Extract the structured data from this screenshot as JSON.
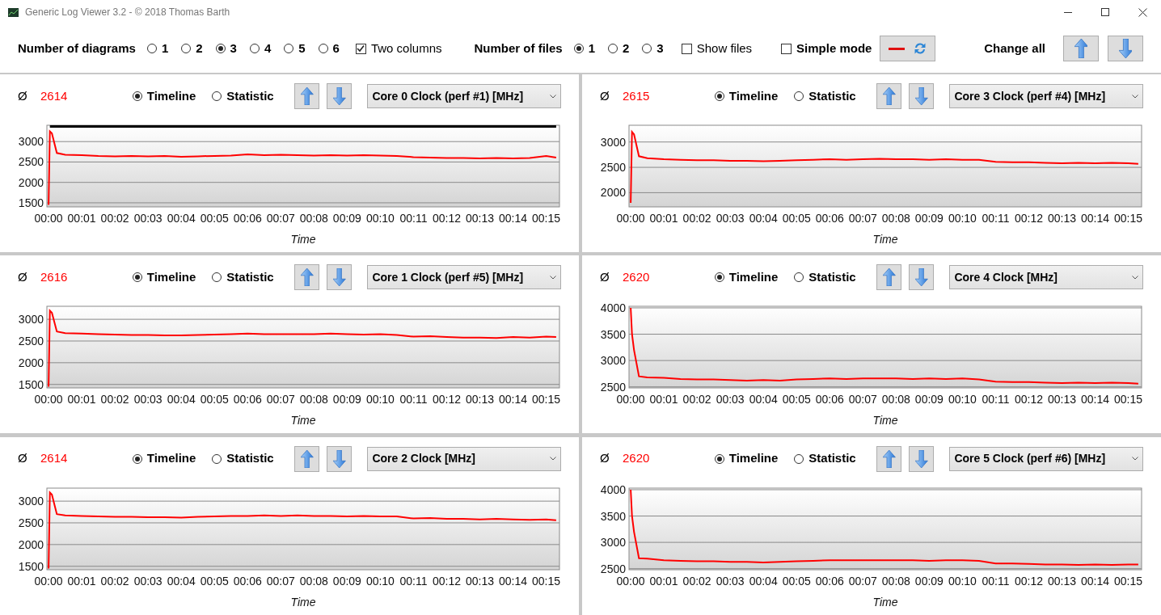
{
  "window": {
    "title": "Generic Log Viewer 3.2 - © 2018 Thomas Barth"
  },
  "toolbar": {
    "diagrams_label": "Number of diagrams",
    "diagram_options": [
      {
        "label": "1",
        "selected": false
      },
      {
        "label": "2",
        "selected": false
      },
      {
        "label": "3",
        "selected": true
      },
      {
        "label": "4",
        "selected": false
      },
      {
        "label": "5",
        "selected": false
      },
      {
        "label": "6",
        "selected": false
      }
    ],
    "two_columns": {
      "label": "Two columns",
      "checked": true
    },
    "files_label": "Number of files",
    "file_options": [
      {
        "label": "1",
        "selected": true
      },
      {
        "label": "2",
        "selected": false
      },
      {
        "label": "3",
        "selected": false
      }
    ],
    "show_files": {
      "label": "Show files",
      "checked": false
    },
    "simple_mode": {
      "label": "Simple mode",
      "checked": false
    },
    "change_all_label": "Change all"
  },
  "panels": [
    {
      "avg_symbol": "Ø",
      "average": "2614",
      "views": [
        {
          "label": "Timeline",
          "selected": true
        },
        {
          "label": "Statistic",
          "selected": false
        }
      ],
      "channel": "Core 0 Clock (perf #1) [MHz]",
      "chart_data": {
        "type": "line",
        "grid": true,
        "xlabel": "Time",
        "x": [
          0,
          0.04,
          0.1,
          0.25,
          0.5,
          1,
          1.5,
          2,
          2.5,
          3,
          3.5,
          4,
          4.5,
          5,
          5.5,
          6,
          6.5,
          7,
          7.5,
          8,
          8.5,
          9,
          9.5,
          10,
          10.5,
          11,
          11.5,
          12,
          12.5,
          13,
          13.5,
          14,
          14.5,
          15,
          15.3
        ],
        "series": [
          {
            "color": "#ff0000",
            "values": [
              1450,
              3250,
              3200,
              2720,
              2680,
              2670,
              2650,
              2640,
              2650,
              2640,
              2650,
              2630,
              2640,
              2650,
              2660,
              2690,
              2670,
              2680,
              2670,
              2660,
              2670,
              2660,
              2670,
              2660,
              2650,
              2620,
              2610,
              2600,
              2600,
              2590,
              2600,
              2590,
              2600,
              2650,
              2610
            ]
          },
          {
            "color": "#000000",
            "values": [
              null,
              3370,
              3370,
              3370,
              3370,
              3370,
              3370,
              3370,
              3370,
              3370,
              3370,
              3370,
              3370,
              3370,
              3370,
              3370,
              3370,
              3370,
              3370,
              3370,
              3370,
              3370,
              3370,
              3370,
              3370,
              3370,
              3370,
              3370,
              3370,
              3370,
              3370,
              3370,
              3370,
              3370,
              3370
            ]
          }
        ],
        "xlim": [
          -0.05,
          15.4
        ],
        "ylim": [
          1400,
          3400
        ],
        "xticks": [
          {
            "value": 0,
            "label": "00:00"
          },
          {
            "value": 1,
            "label": "00:01"
          },
          {
            "value": 2,
            "label": "00:02"
          },
          {
            "value": 3,
            "label": "00:03"
          },
          {
            "value": 4,
            "label": "00:04"
          },
          {
            "value": 5,
            "label": "00:05"
          },
          {
            "value": 6,
            "label": "00:06"
          },
          {
            "value": 7,
            "label": "00:07"
          },
          {
            "value": 8,
            "label": "00:08"
          },
          {
            "value": 9,
            "label": "00:09"
          },
          {
            "value": 10,
            "label": "00:10"
          },
          {
            "value": 11,
            "label": "00:11"
          },
          {
            "value": 12,
            "label": "00:12"
          },
          {
            "value": 13,
            "label": "00:13"
          },
          {
            "value": 14,
            "label": "00:14"
          },
          {
            "value": 15,
            "label": "00:15"
          }
        ],
        "yticks": [
          1500,
          2000,
          2500,
          3000
        ]
      }
    },
    {
      "avg_symbol": "Ø",
      "average": "2615",
      "views": [
        {
          "label": "Timeline",
          "selected": true
        },
        {
          "label": "Statistic",
          "selected": false
        }
      ],
      "channel": "Core 3 Clock (perf #4) [MHz]",
      "chart_data": {
        "type": "line",
        "grid": true,
        "xlabel": "Time",
        "x": [
          0,
          0.04,
          0.1,
          0.25,
          0.5,
          1,
          1.5,
          2,
          2.5,
          3,
          3.5,
          4,
          4.5,
          5,
          5.5,
          6,
          6.5,
          7,
          7.5,
          8,
          8.5,
          9,
          9.5,
          10,
          10.5,
          11,
          11.5,
          12,
          12.5,
          13,
          13.5,
          14,
          14.5,
          15,
          15.3
        ],
        "series": [
          {
            "color": "#ff0000",
            "values": [
              1800,
              3200,
              3150,
              2720,
              2680,
              2660,
              2650,
              2640,
              2640,
              2630,
              2630,
              2620,
              2630,
              2640,
              2650,
              2660,
              2650,
              2660,
              2670,
              2660,
              2660,
              2650,
              2660,
              2650,
              2650,
              2610,
              2600,
              2600,
              2590,
              2580,
              2590,
              2580,
              2590,
              2580,
              2570
            ]
          }
        ],
        "xlim": [
          -0.05,
          15.4
        ],
        "ylim": [
          1720,
          3330
        ],
        "xticks": [
          {
            "value": 0,
            "label": "00:00"
          },
          {
            "value": 1,
            "label": "00:01"
          },
          {
            "value": 2,
            "label": "00:02"
          },
          {
            "value": 3,
            "label": "00:03"
          },
          {
            "value": 4,
            "label": "00:04"
          },
          {
            "value": 5,
            "label": "00:05"
          },
          {
            "value": 6,
            "label": "00:06"
          },
          {
            "value": 7,
            "label": "00:07"
          },
          {
            "value": 8,
            "label": "00:08"
          },
          {
            "value": 9,
            "label": "00:09"
          },
          {
            "value": 10,
            "label": "00:10"
          },
          {
            "value": 11,
            "label": "00:11"
          },
          {
            "value": 12,
            "label": "00:12"
          },
          {
            "value": 13,
            "label": "00:13"
          },
          {
            "value": 14,
            "label": "00:14"
          },
          {
            "value": 15,
            "label": "00:15"
          }
        ],
        "yticks": [
          2000,
          2500,
          3000
        ]
      }
    },
    {
      "avg_symbol": "Ø",
      "average": "2616",
      "views": [
        {
          "label": "Timeline",
          "selected": true
        },
        {
          "label": "Statistic",
          "selected": false
        }
      ],
      "channel": "Core 1 Clock (perf #5) [MHz]",
      "chart_data": {
        "type": "line",
        "grid": true,
        "xlabel": "Time",
        "x": [
          0,
          0.04,
          0.1,
          0.25,
          0.5,
          1,
          1.5,
          2,
          2.5,
          3,
          3.5,
          4,
          4.5,
          5,
          5.5,
          6,
          6.5,
          7,
          7.5,
          8,
          8.5,
          9,
          9.5,
          10,
          10.5,
          11,
          11.5,
          12,
          12.5,
          13,
          13.5,
          14,
          14.5,
          15,
          15.3
        ],
        "series": [
          {
            "color": "#ff0000",
            "values": [
              1450,
              3200,
              3150,
              2720,
              2680,
              2670,
              2660,
              2650,
              2640,
              2640,
              2630,
              2630,
              2640,
              2650,
              2660,
              2670,
              2660,
              2660,
              2660,
              2660,
              2670,
              2660,
              2650,
              2660,
              2640,
              2600,
              2610,
              2590,
              2580,
              2580,
              2570,
              2590,
              2580,
              2600,
              2590
            ]
          }
        ],
        "xlim": [
          -0.05,
          15.4
        ],
        "ylim": [
          1420,
          3300
        ],
        "xticks": [
          {
            "value": 0,
            "label": "00:00"
          },
          {
            "value": 1,
            "label": "00:01"
          },
          {
            "value": 2,
            "label": "00:02"
          },
          {
            "value": 3,
            "label": "00:03"
          },
          {
            "value": 4,
            "label": "00:04"
          },
          {
            "value": 5,
            "label": "00:05"
          },
          {
            "value": 6,
            "label": "00:06"
          },
          {
            "value": 7,
            "label": "00:07"
          },
          {
            "value": 8,
            "label": "00:08"
          },
          {
            "value": 9,
            "label": "00:09"
          },
          {
            "value": 10,
            "label": "00:10"
          },
          {
            "value": 11,
            "label": "00:11"
          },
          {
            "value": 12,
            "label": "00:12"
          },
          {
            "value": 13,
            "label": "00:13"
          },
          {
            "value": 14,
            "label": "00:14"
          },
          {
            "value": 15,
            "label": "00:15"
          }
        ],
        "yticks": [
          1500,
          2000,
          2500,
          3000
        ]
      }
    },
    {
      "avg_symbol": "Ø",
      "average": "2620",
      "views": [
        {
          "label": "Timeline",
          "selected": true
        },
        {
          "label": "Statistic",
          "selected": false
        }
      ],
      "channel": "Core 4 Clock [MHz]",
      "chart_data": {
        "type": "line",
        "grid": true,
        "xlabel": "Time",
        "x": [
          0,
          0.04,
          0.1,
          0.25,
          0.5,
          1,
          1.5,
          2,
          2.5,
          3,
          3.5,
          4,
          4.5,
          5,
          5.5,
          6,
          6.5,
          7,
          7.5,
          8,
          8.5,
          9,
          9.5,
          10,
          10.5,
          11,
          11.5,
          12,
          12.5,
          13,
          13.5,
          14,
          14.5,
          15,
          15.3
        ],
        "series": [
          {
            "color": "#ff0000",
            "values": [
              4000,
              3500,
              3200,
              2700,
              2680,
              2670,
              2650,
              2640,
              2640,
              2630,
              2620,
              2630,
              2620,
              2640,
              2650,
              2660,
              2650,
              2660,
              2660,
              2660,
              2650,
              2660,
              2650,
              2660,
              2640,
              2600,
              2590,
              2590,
              2580,
              2570,
              2580,
              2570,
              2580,
              2570,
              2560
            ]
          }
        ],
        "xlim": [
          -0.05,
          15.4
        ],
        "ylim": [
          2480,
          4030
        ],
        "xticks": [
          {
            "value": 0,
            "label": "00:00"
          },
          {
            "value": 1,
            "label": "00:01"
          },
          {
            "value": 2,
            "label": "00:02"
          },
          {
            "value": 3,
            "label": "00:03"
          },
          {
            "value": 4,
            "label": "00:04"
          },
          {
            "value": 5,
            "label": "00:05"
          },
          {
            "value": 6,
            "label": "00:06"
          },
          {
            "value": 7,
            "label": "00:07"
          },
          {
            "value": 8,
            "label": "00:08"
          },
          {
            "value": 9,
            "label": "00:09"
          },
          {
            "value": 10,
            "label": "00:10"
          },
          {
            "value": 11,
            "label": "00:11"
          },
          {
            "value": 12,
            "label": "00:12"
          },
          {
            "value": 13,
            "label": "00:13"
          },
          {
            "value": 14,
            "label": "00:14"
          },
          {
            "value": 15,
            "label": "00:15"
          }
        ],
        "yticks": [
          2500,
          3000,
          3500,
          4000
        ]
      }
    },
    {
      "avg_symbol": "Ø",
      "average": "2614",
      "views": [
        {
          "label": "Timeline",
          "selected": true
        },
        {
          "label": "Statistic",
          "selected": false
        }
      ],
      "channel": "Core 2 Clock [MHz]",
      "chart_data": {
        "type": "line",
        "grid": true,
        "xlabel": "Time",
        "x": [
          0,
          0.04,
          0.1,
          0.25,
          0.5,
          1,
          1.5,
          2,
          2.5,
          3,
          3.5,
          4,
          4.5,
          5,
          5.5,
          6,
          6.5,
          7,
          7.5,
          8,
          8.5,
          9,
          9.5,
          10,
          10.5,
          11,
          11.5,
          12,
          12.5,
          13,
          13.5,
          14,
          14.5,
          15,
          15.3
        ],
        "series": [
          {
            "color": "#ff0000",
            "values": [
              1450,
              3200,
              3150,
              2700,
              2670,
              2660,
              2650,
              2640,
              2640,
              2630,
              2630,
              2620,
              2640,
              2650,
              2660,
              2660,
              2670,
              2660,
              2670,
              2660,
              2660,
              2650,
              2660,
              2650,
              2650,
              2600,
              2610,
              2590,
              2590,
              2580,
              2590,
              2580,
              2570,
              2580,
              2560
            ]
          }
        ],
        "xlim": [
          -0.05,
          15.4
        ],
        "ylim": [
          1420,
          3300
        ],
        "xticks": [
          {
            "value": 0,
            "label": "00:00"
          },
          {
            "value": 1,
            "label": "00:01"
          },
          {
            "value": 2,
            "label": "00:02"
          },
          {
            "value": 3,
            "label": "00:03"
          },
          {
            "value": 4,
            "label": "00:04"
          },
          {
            "value": 5,
            "label": "00:05"
          },
          {
            "value": 6,
            "label": "00:06"
          },
          {
            "value": 7,
            "label": "00:07"
          },
          {
            "value": 8,
            "label": "00:08"
          },
          {
            "value": 9,
            "label": "00:09"
          },
          {
            "value": 10,
            "label": "00:10"
          },
          {
            "value": 11,
            "label": "00:11"
          },
          {
            "value": 12,
            "label": "00:12"
          },
          {
            "value": 13,
            "label": "00:13"
          },
          {
            "value": 14,
            "label": "00:14"
          },
          {
            "value": 15,
            "label": "00:15"
          }
        ],
        "yticks": [
          1500,
          2000,
          2500,
          3000
        ]
      }
    },
    {
      "avg_symbol": "Ø",
      "average": "2620",
      "views": [
        {
          "label": "Timeline",
          "selected": true
        },
        {
          "label": "Statistic",
          "selected": false
        }
      ],
      "channel": "Core 5 Clock (perf #6) [MHz]",
      "chart_data": {
        "type": "line",
        "grid": true,
        "xlabel": "Time",
        "x": [
          0,
          0.04,
          0.1,
          0.25,
          0.5,
          1,
          1.5,
          2,
          2.5,
          3,
          3.5,
          4,
          4.5,
          5,
          5.5,
          6,
          6.5,
          7,
          7.5,
          8,
          8.5,
          9,
          9.5,
          10,
          10.5,
          11,
          11.5,
          12,
          12.5,
          13,
          13.5,
          14,
          14.5,
          15,
          15.3
        ],
        "series": [
          {
            "color": "#ff0000",
            "values": [
              4000,
              3500,
              3200,
              2700,
              2690,
              2660,
              2650,
              2640,
              2640,
              2630,
              2630,
              2620,
              2630,
              2640,
              2650,
              2660,
              2660,
              2660,
              2660,
              2660,
              2660,
              2650,
              2660,
              2660,
              2650,
              2600,
              2600,
              2590,
              2580,
              2580,
              2570,
              2580,
              2570,
              2580,
              2580
            ]
          }
        ],
        "xlim": [
          -0.05,
          15.4
        ],
        "ylim": [
          2480,
          4030
        ],
        "xticks": [
          {
            "value": 0,
            "label": "00:00"
          },
          {
            "value": 1,
            "label": "00:01"
          },
          {
            "value": 2,
            "label": "00:02"
          },
          {
            "value": 3,
            "label": "00:03"
          },
          {
            "value": 4,
            "label": "00:04"
          },
          {
            "value": 5,
            "label": "00:05"
          },
          {
            "value": 6,
            "label": "00:06"
          },
          {
            "value": 7,
            "label": "00:07"
          },
          {
            "value": 8,
            "label": "00:08"
          },
          {
            "value": 9,
            "label": "00:09"
          },
          {
            "value": 10,
            "label": "00:10"
          },
          {
            "value": 11,
            "label": "00:11"
          },
          {
            "value": 12,
            "label": "00:12"
          },
          {
            "value": 13,
            "label": "00:13"
          },
          {
            "value": 14,
            "label": "00:14"
          },
          {
            "value": 15,
            "label": "00:15"
          }
        ],
        "yticks": [
          2500,
          3000,
          3500,
          4000
        ]
      }
    }
  ]
}
